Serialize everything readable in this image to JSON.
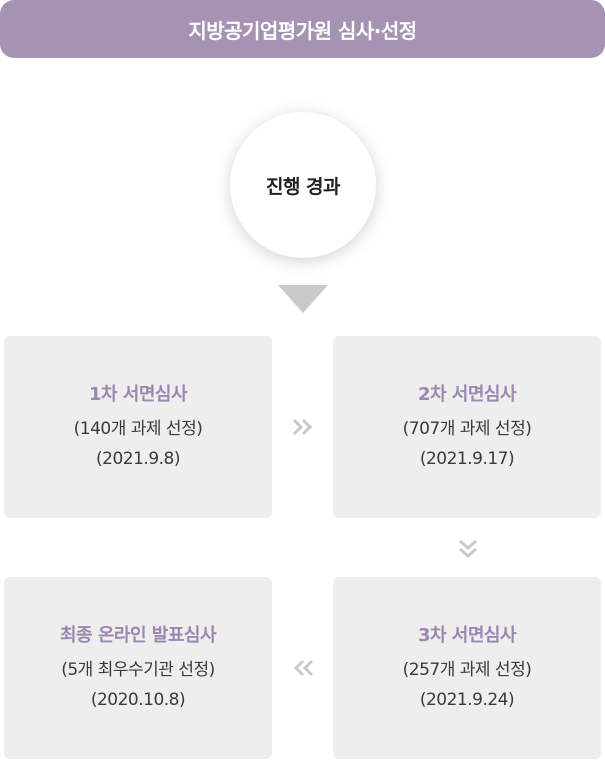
{
  "banner": {
    "title": "지방공기업평가원 심사·선정"
  },
  "progress": {
    "label": "진행 경과"
  },
  "steps": [
    {
      "title": "1차 서면심사",
      "detail": "(140개 과제 선정)",
      "date": "(2021.9.8)"
    },
    {
      "title": "2차 서면심사",
      "detail": "(707개 과제 선정)",
      "date": "(2021.9.17)"
    },
    {
      "title": "3차 서면심사",
      "detail": "(257개 과제 선정)",
      "date": "(2021.9.24)"
    },
    {
      "title": "최종 온라인 발표심사",
      "detail": "(5개 최우수기관 선정)",
      "date": "(2020.10.8)"
    }
  ],
  "colors": {
    "banner": "#a693b4",
    "step_title": "#9c87b0",
    "box": "#eeeeee",
    "arrow": "#c9c9c9"
  },
  "icons": [
    "down-triangle-arrow-icon",
    "double-chevron-right-icon",
    "double-chevron-down-icon",
    "double-chevron-left-icon"
  ]
}
